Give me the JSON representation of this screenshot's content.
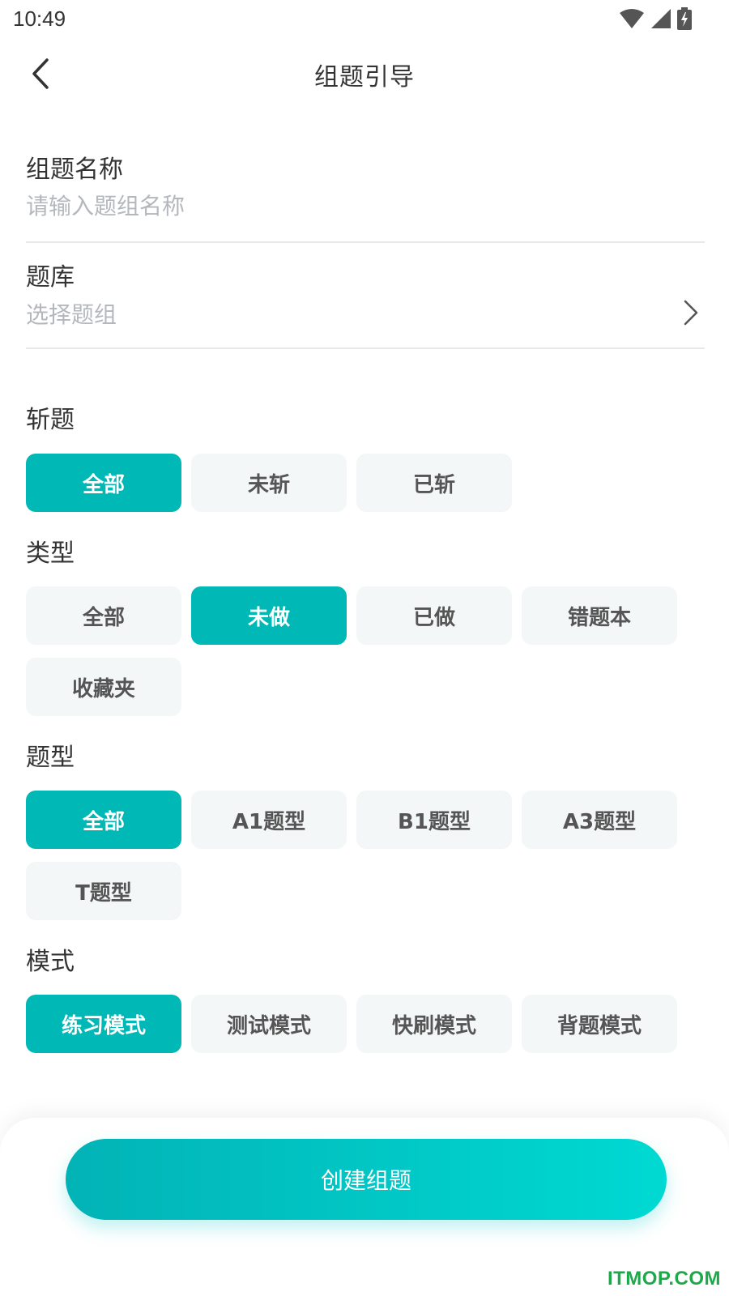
{
  "status_bar": {
    "time": "10:49",
    "icons": [
      "wifi-icon",
      "signal-icon",
      "battery-charging-icon"
    ]
  },
  "nav": {
    "title": "组题引导",
    "back_icon": "chevron-left-icon"
  },
  "form": {
    "name_label": "组题名称",
    "name_placeholder": "请输入题组名称",
    "bank_label": "题库",
    "bank_placeholder": "选择题组"
  },
  "sections": {
    "zhan": {
      "title": "斩题",
      "options": [
        "全部",
        "未斩",
        "已斩"
      ],
      "selected": "全部"
    },
    "type": {
      "title": "类型",
      "options": [
        "全部",
        "未做",
        "已做",
        "错题本",
        "收藏夹"
      ],
      "selected": "未做"
    },
    "qtype": {
      "title": "题型",
      "options": [
        "全部",
        "A1题型",
        "B1题型",
        "A3题型",
        "T题型"
      ],
      "selected": "全部"
    },
    "mode": {
      "title": "模式",
      "options": [
        "练习模式",
        "测试模式",
        "快刷模式",
        "背题模式"
      ],
      "selected": "练习模式"
    }
  },
  "create_button": "创建组题",
  "watermark": "ITMOP.COM",
  "colors": {
    "accent": "#00b8b5",
    "chip_bg": "#f4f7f8",
    "gradient_start": "#02b3b6",
    "gradient_end": "#00d9d3",
    "watermark": "#1ea84a"
  }
}
